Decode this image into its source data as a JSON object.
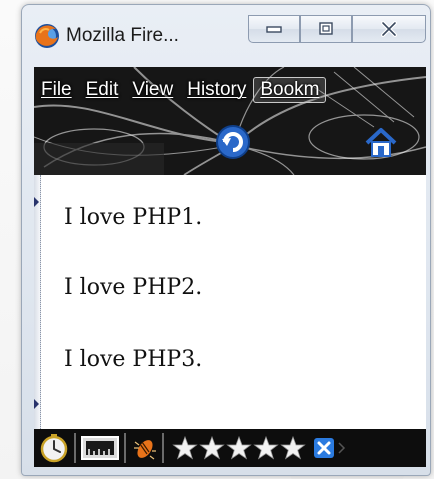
{
  "window": {
    "title": "Mozilla Fire...",
    "accent": "#1e1e1e"
  },
  "caption_buttons": [
    "minimize",
    "maximize",
    "close"
  ],
  "menu": {
    "items": [
      {
        "label": "File"
      },
      {
        "label": "Edit"
      },
      {
        "label": "View"
      },
      {
        "label": "History"
      },
      {
        "label": "Bookm"
      }
    ]
  },
  "toolbar_icons": [
    "reload-icon",
    "home-icon"
  ],
  "content": {
    "lines": [
      "I love PHP1.",
      "I love PHP2.",
      "I love PHP3."
    ]
  },
  "statusbar": {
    "icons": [
      "speed-dial-icon",
      "screen-ruler-icon",
      "firebug-icon",
      "rating-stars",
      "addon-x-icon"
    ],
    "stars_filled": 5,
    "stars_total": 5
  }
}
